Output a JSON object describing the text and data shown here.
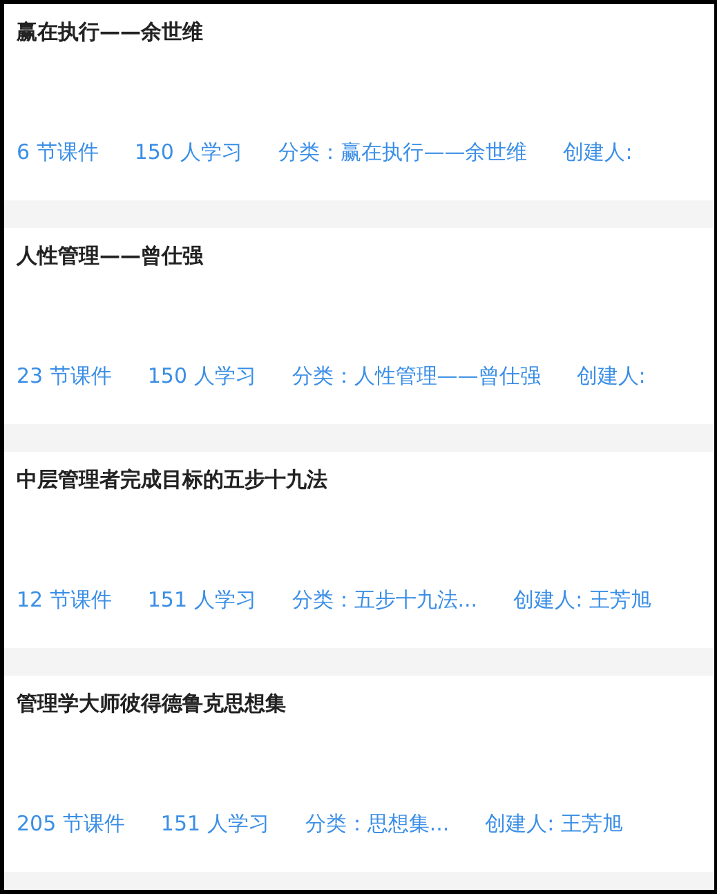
{
  "courses": [
    {
      "title": "赢在执行——余世维",
      "lessons": "6 节课件",
      "learners": "150 人学习",
      "category": "分类：赢在执行——余世维",
      "creator": "创建人:"
    },
    {
      "title": "人性管理——曾仕强",
      "lessons": "23 节课件",
      "learners": "150 人学习",
      "category": "分类：人性管理——曾仕强",
      "creator": "创建人:"
    },
    {
      "title": "中层管理者完成目标的五步十九法",
      "lessons": "12 节课件",
      "learners": "151 人学习",
      "category": "分类：五步十九法...",
      "creator": "创建人: 王芳旭"
    },
    {
      "title": "管理学大师彼得德鲁克思想集",
      "lessons": "205 节课件",
      "learners": "151 人学习",
      "category": "分类：思想集...",
      "creator": "创建人: 王芳旭"
    }
  ]
}
